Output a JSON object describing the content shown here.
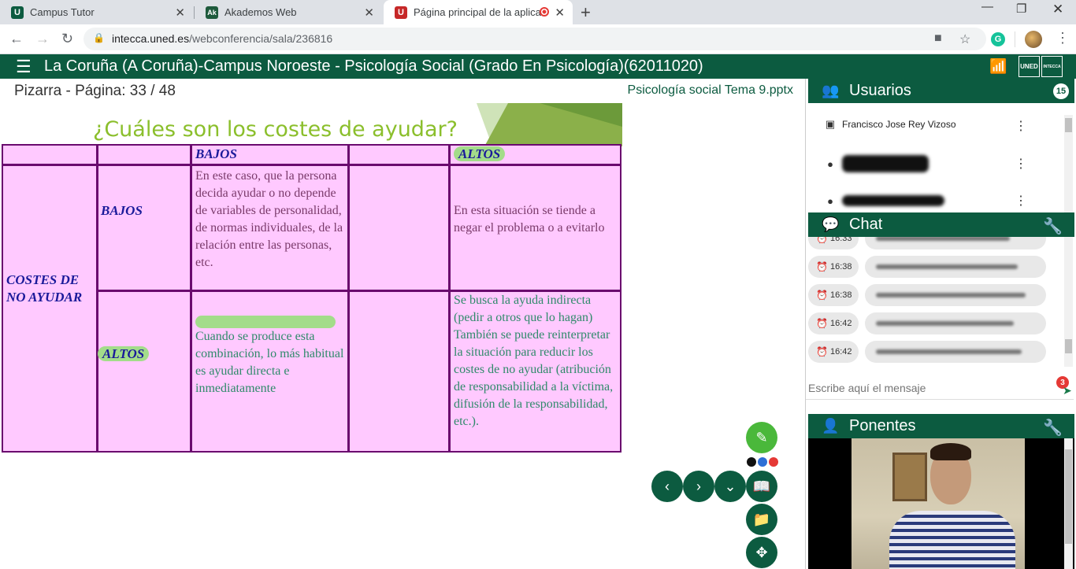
{
  "browser": {
    "tabs": [
      {
        "title": "Campus Tutor",
        "favicon": "U",
        "favicon_color": "#0c5b40",
        "active": false
      },
      {
        "title": "Akademos Web",
        "favicon": "Ak",
        "favicon_color": "#1e5a3c",
        "active": false
      },
      {
        "title": "Página principal de la aplicac",
        "favicon": "U",
        "favicon_color": "#c62828",
        "active": true
      }
    ],
    "new_tab_icon": "+",
    "url_host": "intecca.uned.es",
    "url_path": "/webconferencia/sala/236816"
  },
  "app": {
    "title": "La Coruña (A Coruña)-Campus Noroeste - Psicología Social (Grado En Psicología)(62011020)",
    "logo_uned": "UNED",
    "logo_intecca": "INTECCA",
    "brand_color": "#0c5b40"
  },
  "whiteboard": {
    "title": "Pizarra - Página: 33 / 48",
    "file": "Psicología social Tema 9.pptx"
  },
  "slide": {
    "heading": "¿Cuáles son los costes de ayudar?",
    "col_bajos": "BAJOS",
    "col_altos": "ALTOS",
    "row_label": "COSTES DE NO AYUDAR",
    "row_bajos": "BAJOS",
    "row_altos": "ALTOS",
    "cell_bajos_bajos": "En este caso, que la persona decida ayudar o no depende de variables de personalidad, de normas individuales, de la relación entre las personas, etc.",
    "cell_bajos_altos": "En esta situación se tiende a negar el problema o a evitarlo",
    "cell_altos_bajos": "Cuando se produce esta combinación, lo más habitual es ayudar directa e inmediatamente",
    "cell_altos_altos": "Se busca la ayuda indirecta (pedir a otros que lo hagan) También se puede reinterpretar la situación para reducir los costes de no ayudar (atribución de responsabilidad a la víctima, difusión de la responsabilidad, etc.)."
  },
  "users_panel": {
    "title": "Usuarios",
    "count": "15",
    "users": [
      {
        "name": "Francisco Jose Rey Vizoso"
      }
    ]
  },
  "chat_panel": {
    "title": "Chat",
    "times": [
      "16:33",
      "16:38",
      "16:38",
      "16:42",
      "16:42"
    ],
    "input_placeholder": "Escribe aquí el mensaje",
    "unread": "3"
  },
  "speakers_panel": {
    "title": "Ponentes"
  }
}
